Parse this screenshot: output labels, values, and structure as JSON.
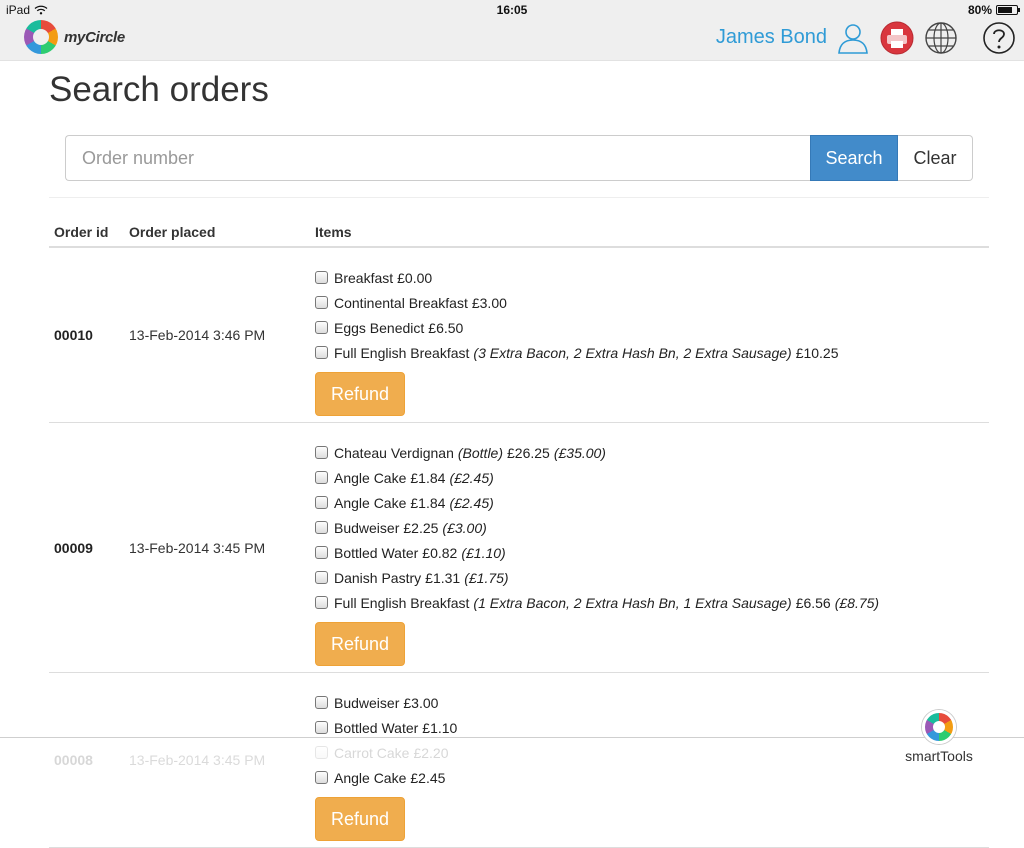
{
  "status_bar": {
    "device": "iPad",
    "time": "16:05",
    "battery": "80%",
    "battery_level": 0.8
  },
  "header": {
    "logo_text": "myCircle",
    "user_name": "James Bond",
    "icons": [
      "user-icon",
      "printer-icon",
      "globe-icon",
      "help-icon"
    ]
  },
  "page": {
    "title": "Search orders"
  },
  "search": {
    "placeholder": "Order number",
    "value": "",
    "search_label": "Search",
    "clear_label": "Clear"
  },
  "table": {
    "columns": [
      "Order id",
      "Order placed",
      "Items"
    ],
    "orders": [
      {
        "id": "00010",
        "placed": "13-Feb-2014 3:46 PM",
        "items": [
          {
            "name": "Breakfast",
            "modifiers": "",
            "price": "£0.00",
            "original": ""
          },
          {
            "name": "Continental Breakfast",
            "modifiers": "",
            "price": "£3.00",
            "original": ""
          },
          {
            "name": "Eggs Benedict",
            "modifiers": "",
            "price": "£6.50",
            "original": ""
          },
          {
            "name": "Full English Breakfast",
            "modifiers": "(3 Extra Bacon, 2 Extra Hash Bn, 2 Extra Sausage)",
            "price": "£10.25",
            "original": ""
          }
        ],
        "refund_label": "Refund"
      },
      {
        "id": "00009",
        "placed": "13-Feb-2014 3:45 PM",
        "items": [
          {
            "name": "Chateau Verdignan",
            "modifiers": "(Bottle)",
            "price": "£26.25",
            "original": "(£35.00)"
          },
          {
            "name": "Angle Cake",
            "modifiers": "",
            "price": "£1.84",
            "original": "(£2.45)"
          },
          {
            "name": "Angle Cake",
            "modifiers": "",
            "price": "£1.84",
            "original": "(£2.45)"
          },
          {
            "name": "Budweiser",
            "modifiers": "",
            "price": "£2.25",
            "original": "(£3.00)"
          },
          {
            "name": "Bottled Water",
            "modifiers": "",
            "price": "£0.82",
            "original": "(£1.10)"
          },
          {
            "name": "Danish Pastry",
            "modifiers": "",
            "price": "£1.31",
            "original": "(£1.75)"
          },
          {
            "name": "Full English Breakfast",
            "modifiers": "(1 Extra Bacon, 2 Extra Hash Bn, 1 Extra Sausage)",
            "price": "£6.56",
            "original": "(£8.75)"
          }
        ],
        "refund_label": "Refund"
      },
      {
        "id": "00008",
        "placed": "13-Feb-2014 3:45 PM",
        "items": [
          {
            "name": "Budweiser",
            "modifiers": "",
            "price": "£3.00",
            "original": ""
          },
          {
            "name": "Bottled Water",
            "modifiers": "",
            "price": "£1.10",
            "original": ""
          },
          {
            "name": "Carrot Cake",
            "modifiers": "",
            "price": "£2.20",
            "original": ""
          },
          {
            "name": "Angle Cake",
            "modifiers": "",
            "price": "£2.45",
            "original": ""
          }
        ],
        "refund_label": "Refund"
      }
    ]
  },
  "footer": {
    "smarttools_label": "smartTools"
  },
  "colors": {
    "accent_blue": "#428bca",
    "refund_orange": "#f0ad4e",
    "username_blue": "#2f9bd6",
    "printer_red": "#d9363e"
  }
}
